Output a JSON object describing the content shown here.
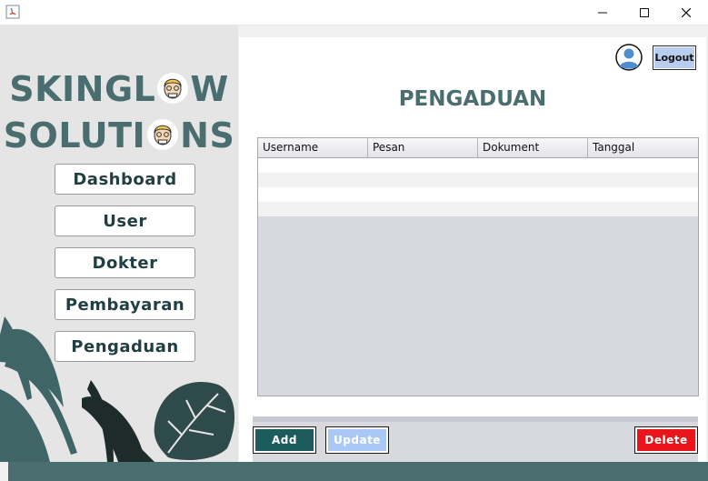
{
  "window": {
    "title": "",
    "controls": [
      "minimize-icon",
      "maximize-icon",
      "close-icon"
    ]
  },
  "brand": {
    "line1_prefix": "SKINGL",
    "line1_suffix": "W",
    "line2_prefix": "SOLUTI",
    "line2_suffix": "NS",
    "logo_icon": "face-logo-icon",
    "color": "#4a6e70"
  },
  "sidebar": {
    "items": [
      {
        "label": "Dashboard"
      },
      {
        "label": "User"
      },
      {
        "label": "Dokter"
      },
      {
        "label": "Pembayaran"
      },
      {
        "label": "Pengaduan"
      }
    ]
  },
  "header": {
    "avatar_icon": "user-avatar-icon",
    "logout_label": "Logout"
  },
  "page": {
    "title": "PENGADUAN"
  },
  "table": {
    "columns": [
      "Username",
      "Pesan",
      "Dokument",
      "Tanggal"
    ],
    "rows": []
  },
  "actions": {
    "add_label": "Add",
    "update_label": "Update",
    "delete_label": "Delete"
  },
  "colors": {
    "accent": "#4a6e70",
    "add": "#1c5c5e",
    "update": "#a9c8f5",
    "delete": "#e8151a",
    "logout": "#b9cdf0"
  }
}
